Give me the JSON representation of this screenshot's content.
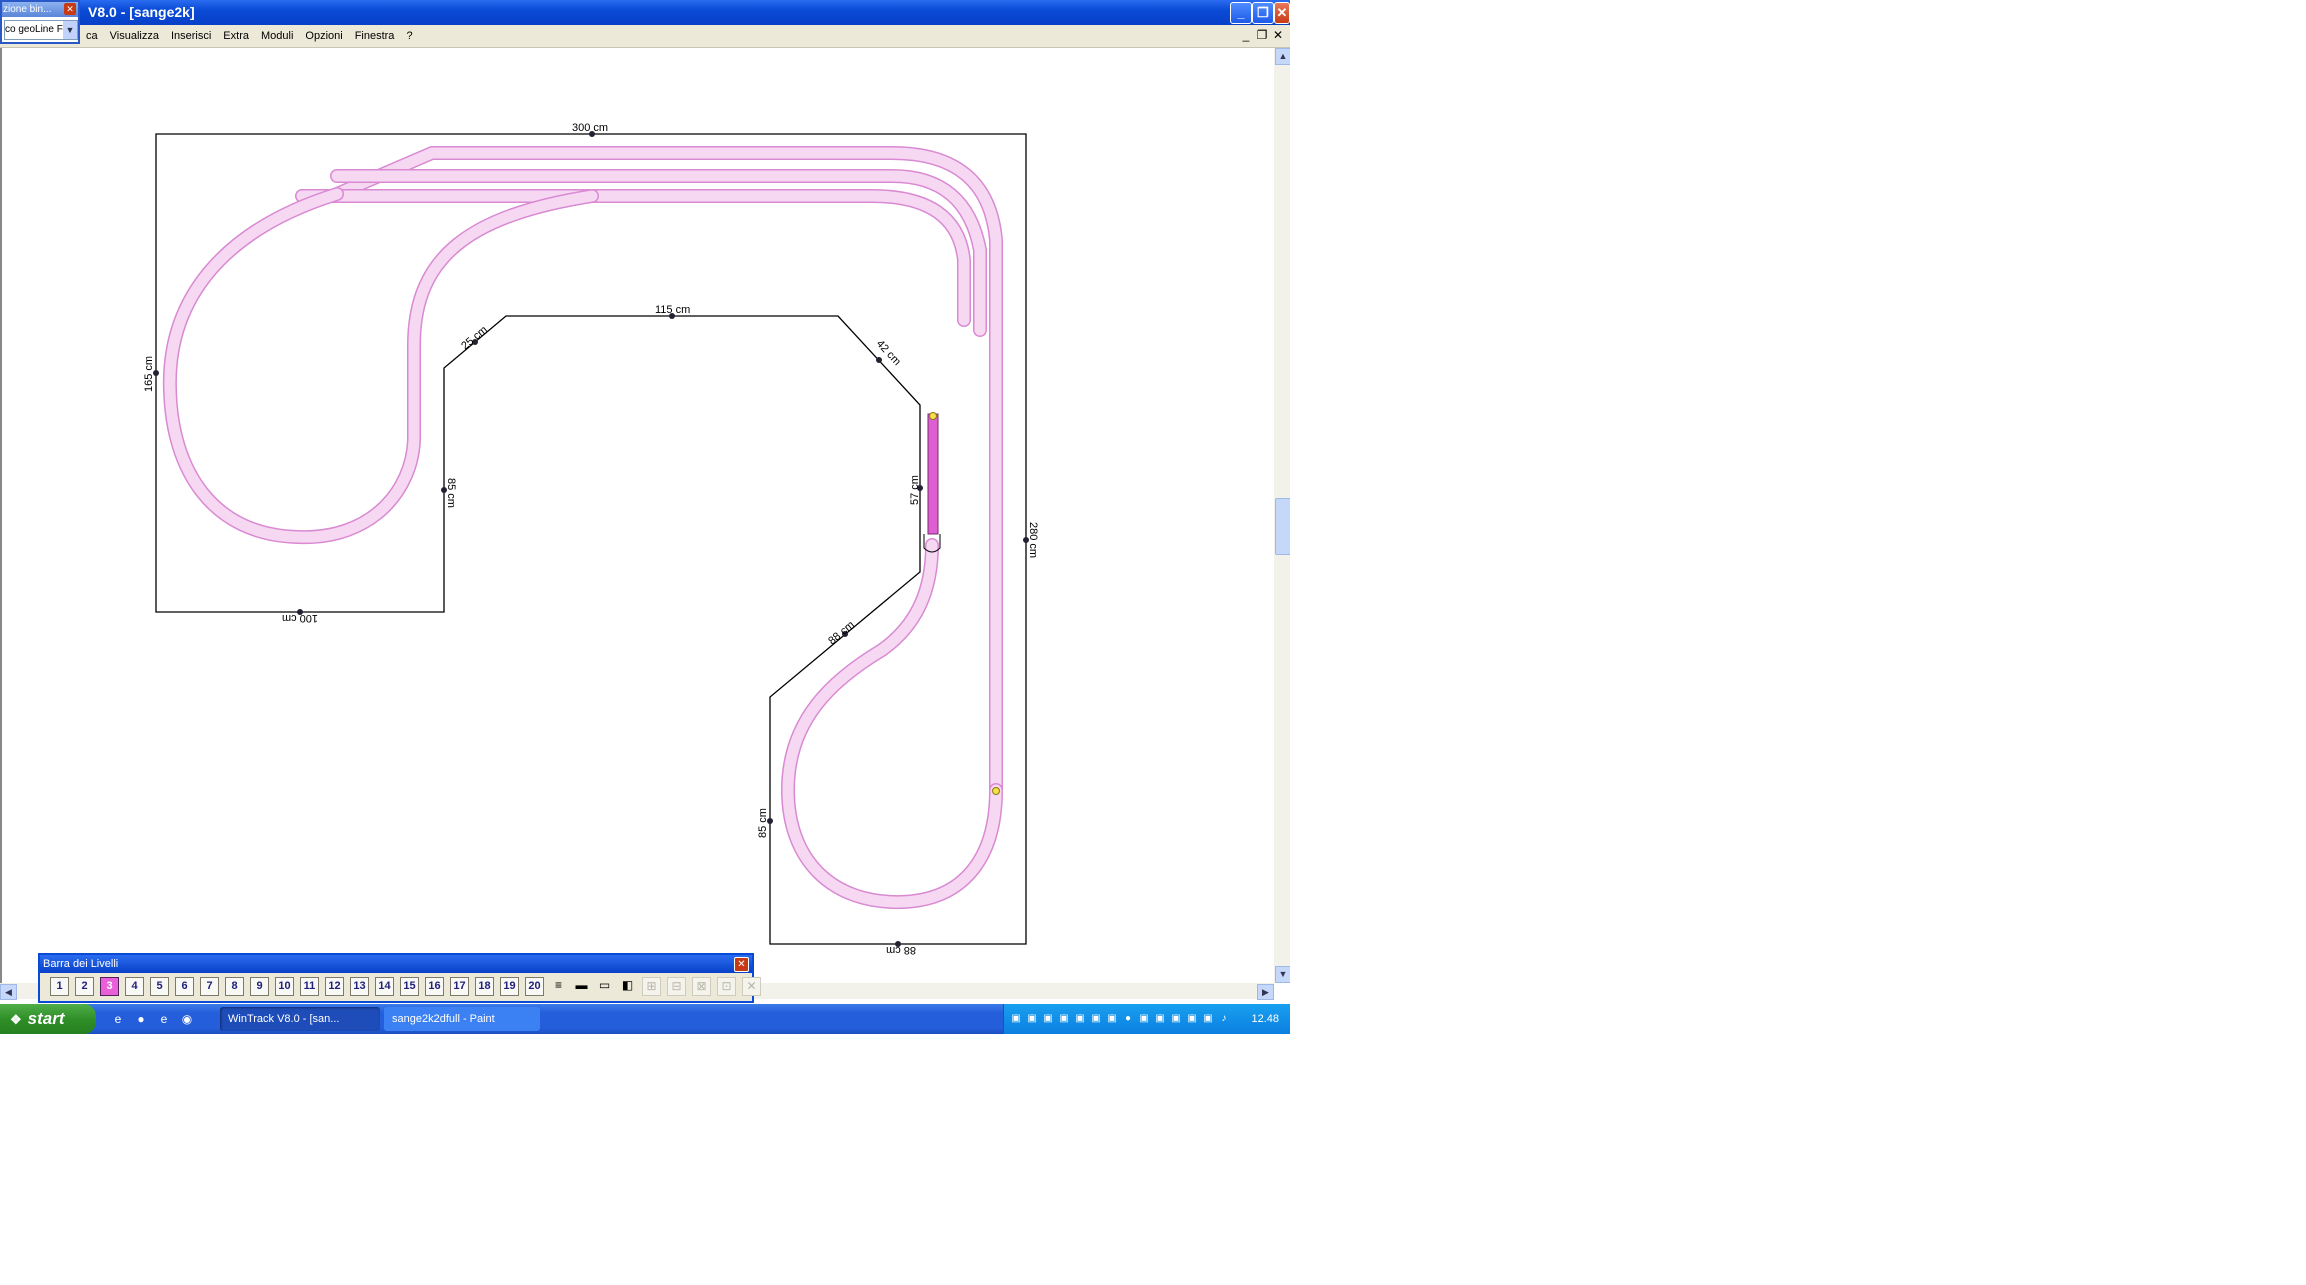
{
  "window": {
    "title": "V8.0 - [sange2k]",
    "minimize_icon": "minimize-icon",
    "maximize_icon": "restore-icon",
    "close_icon": "close-icon"
  },
  "floating_panel": {
    "title": "zione bin...",
    "select_value": "co geoLine F"
  },
  "menu": {
    "items": [
      "ca",
      "Visualizza",
      "Inserisci",
      "Extra",
      "Moduli",
      "Opzioni",
      "Finestra",
      "?"
    ]
  },
  "dimensions": {
    "top": "300 cm",
    "left": "165 cm",
    "bottom_left": "100 cm",
    "inner_left": "85 cm",
    "diag1": "25 cm",
    "inner_top": "115 cm",
    "diag2": "42 cm",
    "inner_right": "57 cm",
    "right": "280 cm",
    "diag3": "88 cm",
    "bottom_inner_left": "85 cm",
    "bottom_right": "88 cm"
  },
  "levels_bar": {
    "title": "Barra dei Livelli",
    "levels": [
      "1",
      "2",
      "3",
      "4",
      "5",
      "6",
      "7",
      "8",
      "9",
      "10",
      "11",
      "12",
      "13",
      "14",
      "15",
      "16",
      "17",
      "18",
      "19",
      "20"
    ],
    "active_level": "3"
  },
  "taskbar": {
    "start_label": "start",
    "tasks": [
      {
        "label": "WinTrack V8.0 - [san..."
      },
      {
        "label": "sange2k2dfull - Paint"
      }
    ],
    "clock": "12.48"
  },
  "colors": {
    "track": "#f2c6ef",
    "track_edge": "#d98ad2",
    "titlebar": "#0a4bd6",
    "taskbar": "#245edb",
    "start": "#2f8f28",
    "active_level": "#e85fd8"
  }
}
